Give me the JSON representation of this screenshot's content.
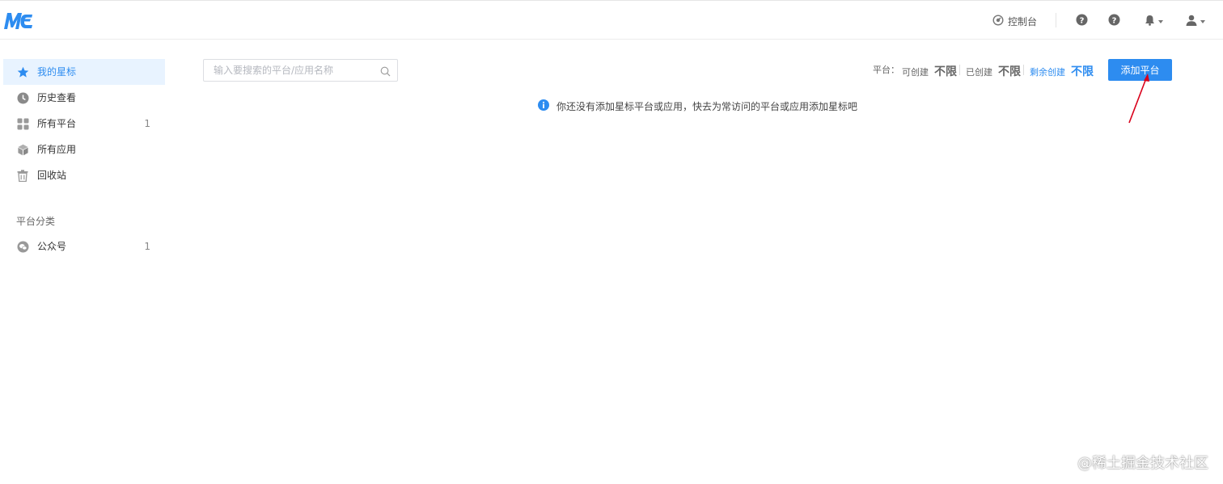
{
  "header": {
    "logo_text": "ME",
    "console_label": "控制台",
    "icons": [
      "help-circle-icon",
      "help-circle-icon",
      "bell-icon",
      "user-icon"
    ]
  },
  "sidebar": {
    "items": [
      {
        "label": "我的星标",
        "icon": "star-icon",
        "count": "",
        "active": true
      },
      {
        "label": "历史查看",
        "icon": "clock-icon",
        "count": ""
      },
      {
        "label": "所有平台",
        "icon": "grid-icon",
        "count": "1"
      },
      {
        "label": "所有应用",
        "icon": "cube-icon",
        "count": ""
      },
      {
        "label": "回收站",
        "icon": "trash-icon",
        "count": ""
      }
    ],
    "category_title": "平台分类",
    "categories": [
      {
        "label": "公众号",
        "icon": "wechat-icon",
        "count": "1"
      }
    ]
  },
  "main": {
    "search_placeholder": "输入要搜索的平台/应用名称",
    "quota": {
      "label": "平台：",
      "can_create_label": "可创建",
      "can_create_value": "不限",
      "created_label": "已创建",
      "created_value": "不限",
      "remaining_label": "剩余创建",
      "remaining_value": "不限"
    },
    "add_button_label": "添加平台",
    "empty_notice": "你还没有添加星标平台或应用，快去为常访问的平台或应用添加星标吧"
  },
  "watermark": "@稀土掘金技术社区",
  "colors": {
    "accent": "#2d8cf0",
    "active_bg": "#e8f3ff",
    "annotation_arrow": "#d9001b"
  }
}
